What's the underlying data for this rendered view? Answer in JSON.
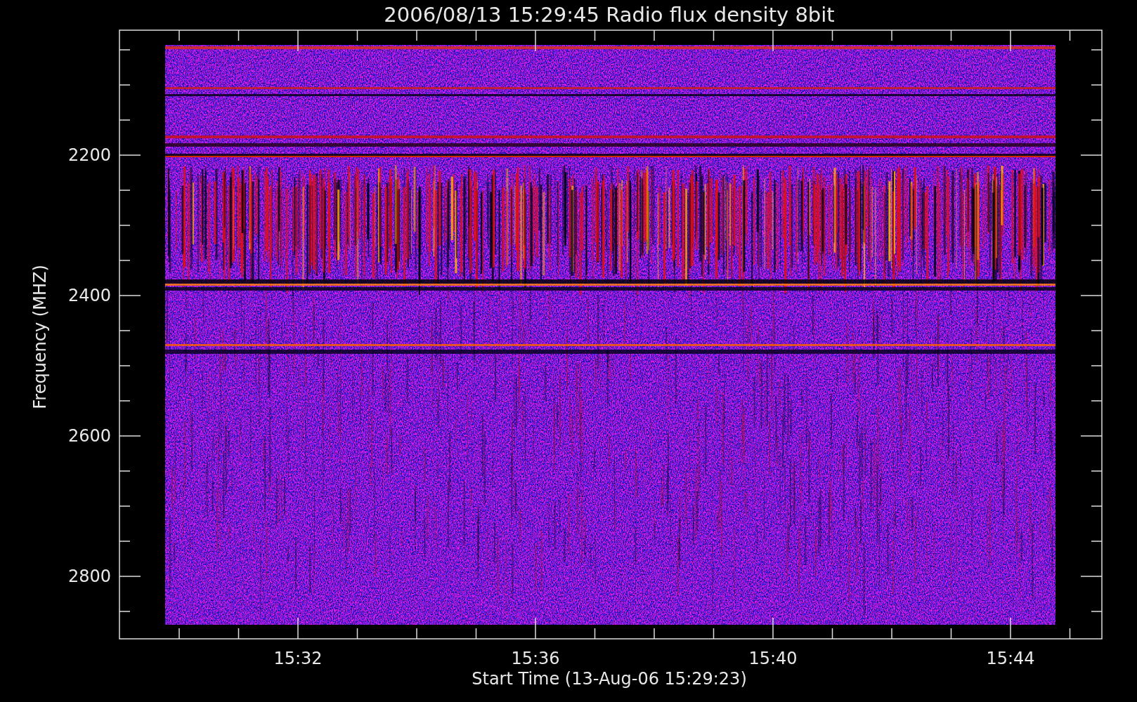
{
  "title": "2006/08/13 15:29:45 Radio flux density 8bit",
  "plot": {
    "ylabel": "Frequency (MHZ)",
    "xlabel": "Start Time (13-Aug-06 15:29:23)",
    "yticks": [
      "2200",
      "2400",
      "2600",
      "2800"
    ],
    "xticks": [
      "15:32",
      "15:36",
      "15:40",
      "15:44"
    ]
  }
}
